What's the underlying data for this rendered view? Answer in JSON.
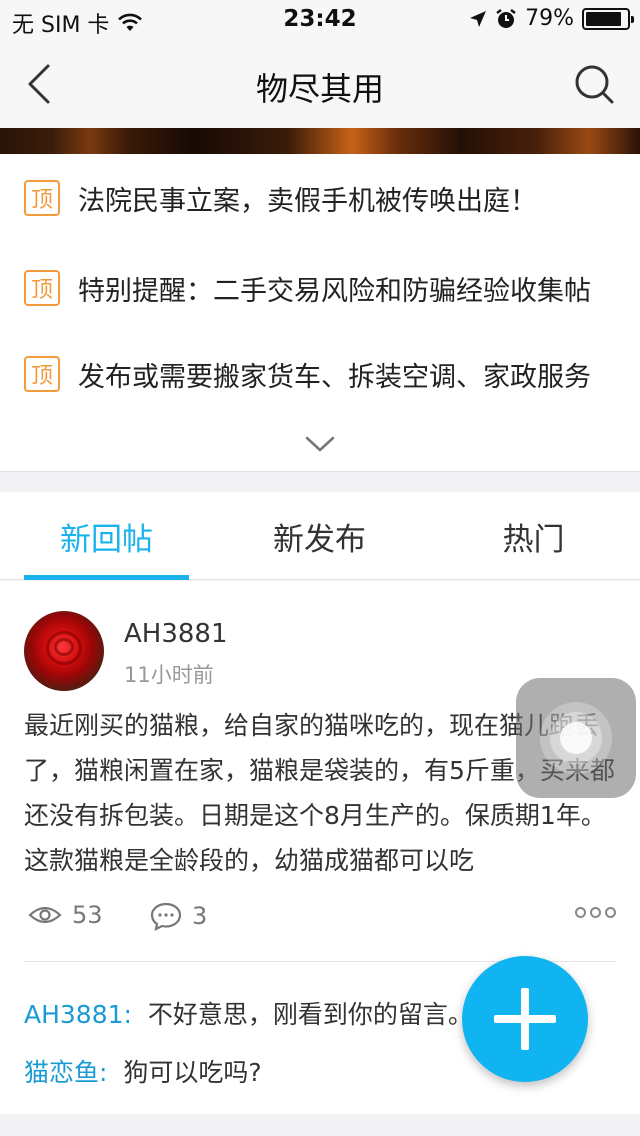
{
  "status_bar": {
    "carrier": "无 SIM 卡",
    "time": "23:42",
    "battery_percent": "79%",
    "battery_level": 0.79,
    "icons": [
      "wifi-icon",
      "location-arrow-icon",
      "alarm-icon",
      "battery-icon"
    ]
  },
  "nav": {
    "title": "物尽其用",
    "back_icon": "chevron-left-icon",
    "search_icon": "search-icon"
  },
  "pinned": {
    "badge": "顶",
    "items": [
      {
        "text": "法院民事立案，卖假手机被传唤出庭！"
      },
      {
        "text": "特别提醒：二手交易风险和防骗经验收集帖"
      },
      {
        "text": "发布或需要搬家货车、拆装空调、家政服务"
      }
    ],
    "expand_icon": "chevron-down-icon"
  },
  "tabs": [
    {
      "label": "新回帖",
      "active": true
    },
    {
      "label": "新发布",
      "active": false
    },
    {
      "label": "热门",
      "active": false
    }
  ],
  "post": {
    "author": "AH3881",
    "time": "11小时前",
    "body": "最近刚买的猫粮，给自家的猫咪吃的，现在猫儿跑丢了，猫粮闲置在家，猫粮是袋装的，有5斤重，买来都还没有拆包装。日期是这个8月生产的。保质期1年。这款猫粮是全龄段的，幼猫成猫都可以吃",
    "views": "53",
    "comments": "3",
    "replies": [
      {
        "name": "AH3881",
        "sep": ":",
        "text": "不好意思，刚看到你的留言。"
      },
      {
        "name": "猫恋鱼",
        "sep": ":",
        "text": "狗可以吃吗?"
      }
    ]
  },
  "colors": {
    "accent": "#1ab3ec",
    "pin_badge": "#f29b3c",
    "reply_name": "#1a9bd4",
    "fab": "#10b4f0"
  }
}
